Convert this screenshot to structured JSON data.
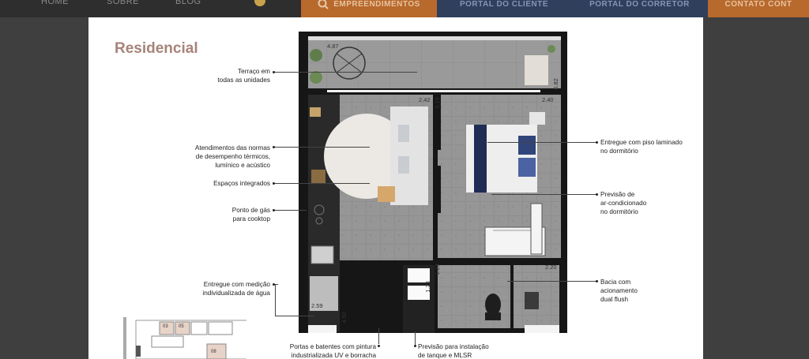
{
  "nav": {
    "links": [
      "HOME",
      "SOBRE",
      "BLOG"
    ],
    "empreendimentos": "EMPREENDIMENTOS",
    "portal_cliente": "PORTAL DO CLIENTE",
    "portal_corretor": "PORTAL DO CORRETOR",
    "contato": "CONTATO CONT"
  },
  "colors": {
    "accent": "#c97a3a",
    "navy": "#2f3f5c",
    "title": "#a7837a"
  },
  "section_title": "Residencial",
  "features_left": [
    "Terraço em\ntodas as unidades",
    "Atendimentos das normas\nde desempenho térmicos,\nlumínico e acústico",
    "Espaços integrados",
    "Ponto de gás\npara cooktop",
    "Entregue com medição\nindividualizada de água"
  ],
  "features_right": [
    "Entregue com piso laminado\nno dormitório",
    "Previsão de\nar-condicionado\nno dormitório",
    "Bacia com\nacionamento\ndual flush"
  ],
  "features_bottom": [
    "Portas e batentes com pintura\nindustrializada UV e borracha",
    "Previsão para instalação\nde tanque e MLSR"
  ],
  "dimensions": [
    "4.87",
    "0.82",
    "2.42",
    "3.19",
    "2.40",
    "1.23",
    "1.23",
    "2.20",
    "2.59",
    "4.50"
  ],
  "keyplan_units": [
    "03",
    "05",
    "08"
  ]
}
